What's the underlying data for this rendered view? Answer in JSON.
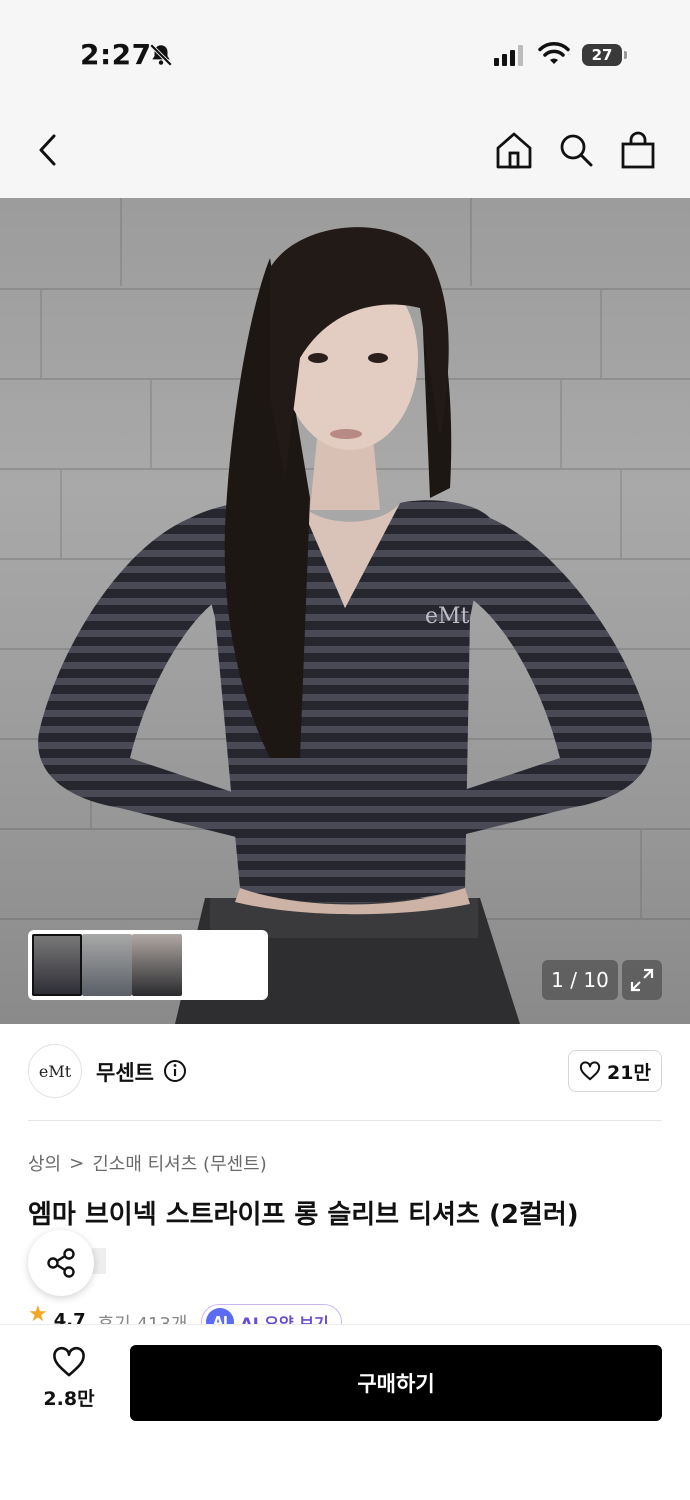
{
  "status_bar": {
    "time": "2:27",
    "battery": "27",
    "icons": [
      "bell-slash-icon",
      "cellular-signal-icon",
      "wifi-icon",
      "battery-icon"
    ]
  },
  "nav": {
    "icons": [
      "back-chevron-icon",
      "home-icon",
      "search-icon",
      "shopping-bag-icon"
    ]
  },
  "gallery": {
    "counter": "1 / 10",
    "expand_icon": "expand-icon",
    "thumbnail_count": 3
  },
  "brand": {
    "name": "무센트",
    "logo_text": "eMt",
    "likes": "21만"
  },
  "breadcrumb": {
    "category": "상의",
    "separator": ">",
    "subcategory": "긴소매 티셔츠 (무센트)"
  },
  "product": {
    "title": "엠마 브이넥 스트라이프 롱 슬리브 티셔츠 (2컬러)",
    "rating": "4.7",
    "reviews": "후기 413개",
    "ai_badge": "AI",
    "ai_summary": "AI 요약 보기"
  },
  "bottom_bar": {
    "wishlist_count": "2.8만",
    "buy_label": "구매하기"
  },
  "colors": {
    "accent_star": "#f5a623",
    "ai_purple": "#6b4cd1",
    "buy_button": "#000000"
  }
}
